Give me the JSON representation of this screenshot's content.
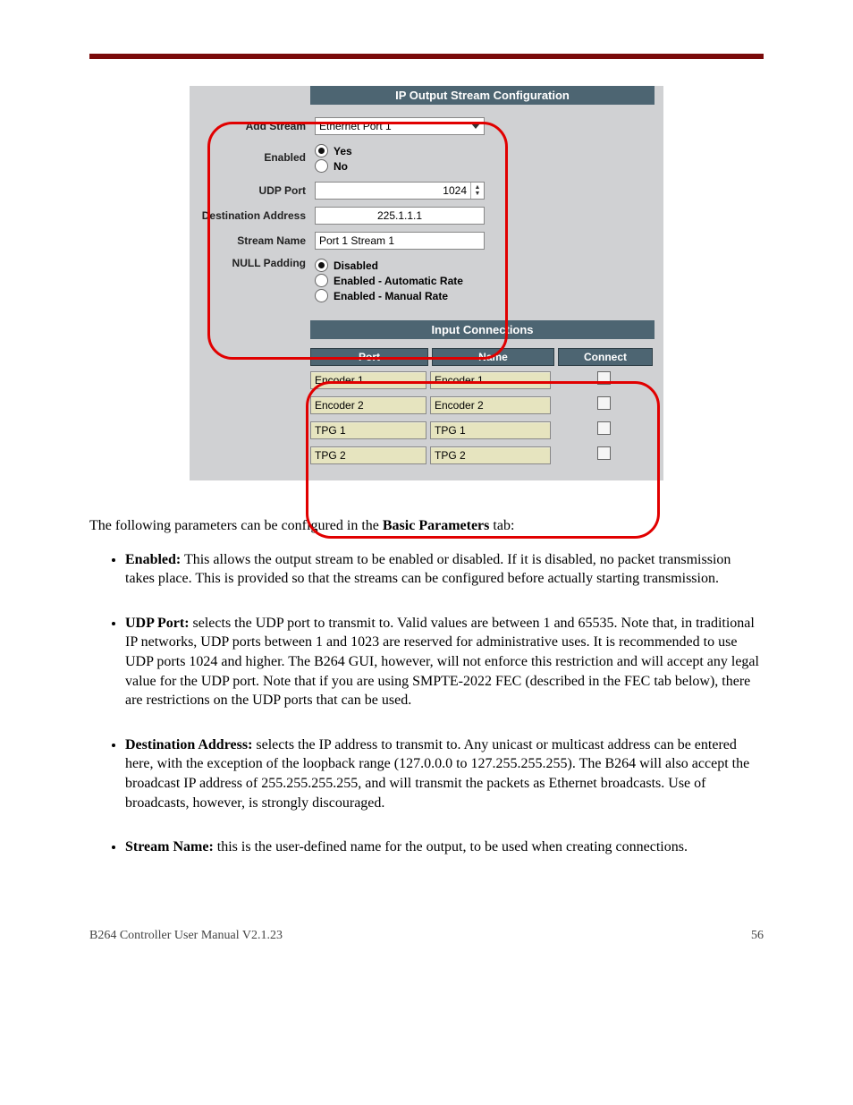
{
  "config_header": "IP Output Stream Configuration",
  "labels": {
    "add_stream": "Add Stream",
    "enabled": "Enabled",
    "udp_port": "UDP Port",
    "dest_addr": "Destination Address",
    "stream_name": "Stream Name",
    "null_padding": "NULL Padding"
  },
  "add_stream_selected": "Ethernet Port 1",
  "enabled_options": {
    "yes": "Yes",
    "no": "No"
  },
  "udp_port_value": "1024",
  "dest_addr_value": "225.1.1.1",
  "stream_name_value": "Port 1 Stream 1",
  "null_options": {
    "disabled": "Disabled",
    "auto": "Enabled - Automatic Rate",
    "manual": "Enabled - Manual Rate"
  },
  "input_header": "Input Connections",
  "th": {
    "port": "Port",
    "name": "Name",
    "connect": "Connect"
  },
  "rows": [
    {
      "port": "Encoder 1",
      "name": "Encoder 1"
    },
    {
      "port": "Encoder 2",
      "name": "Encoder 2"
    },
    {
      "port": "TPG 1",
      "name": "TPG 1"
    },
    {
      "port": "TPG 2",
      "name": "TPG 2"
    }
  ],
  "b0_prefix": "The following parameters can be configured in the ",
  "b0_bold": "Basic Parameters",
  "b0_suffix": " tab:",
  "b1_bold": "Enabled:",
  "b1_rest": " This allows the output stream to be enabled or disabled.  If it is disabled, no packet transmission takes place.  This is provided so that the streams can be configured before actually starting transmission.",
  "b2_bold": "UDP Port:",
  "b2_rest": " selects the UDP port to transmit to.  Valid values are between 1 and 65535.  Note that, in traditional IP networks, UDP ports between 1 and 1023 are reserved for administrative uses.  It is recommended to use UDP ports 1024 and higher.  The B264 GUI, however, will not enforce this restriction and will accept any legal value for the UDP port.  Note that if you are using SMPTE-2022 FEC (described in the FEC tab below), there are restrictions on the UDP ports that can be used.",
  "b3_bold": "Destination Address:",
  "b3_rest": " selects the IP address to transmit to.  Any unicast or multicast address can be entered here, with the exception of the loopback range (127.0.0.0 to 127.255.255.255).  The B264 will also accept the broadcast IP address of 255.255.255.255, and will transmit the packets as Ethernet broadcasts.  Use of broadcasts, however, is strongly discouraged.",
  "b4_bold": "Stream Name:",
  "b4_rest": " this is the user-defined name for the output, to be used when creating connections.",
  "footer_left": "B264 Controller User Manual V2.1.23",
  "footer_right": "56"
}
